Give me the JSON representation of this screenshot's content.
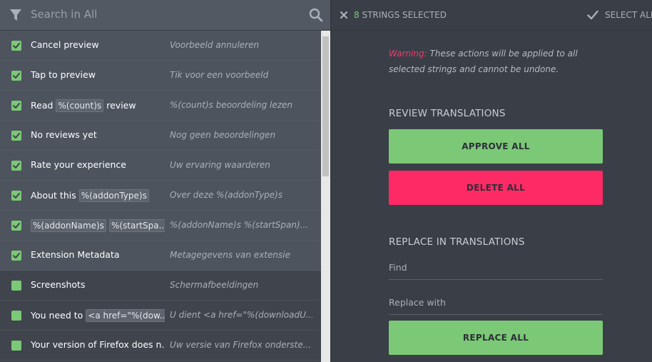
{
  "search": {
    "placeholder": "Search in All"
  },
  "strings": [
    {
      "selected": true,
      "source": [
        {
          "t": "Cancel preview"
        }
      ],
      "translation": "Voorbeeld annuleren"
    },
    {
      "selected": true,
      "source": [
        {
          "t": "Tap to preview"
        }
      ],
      "translation": "Tik voor een voorbeeld"
    },
    {
      "selected": true,
      "source": [
        {
          "t": "Read "
        },
        {
          "p": "%(count)s"
        },
        {
          "t": " review"
        }
      ],
      "translation": "%(count)s beoordeling lezen"
    },
    {
      "selected": true,
      "source": [
        {
          "t": "No reviews yet"
        }
      ],
      "translation": "Nog geen beoordelingen"
    },
    {
      "selected": true,
      "source": [
        {
          "t": "Rate your experience"
        }
      ],
      "translation": "Uw ervaring waarderen"
    },
    {
      "selected": true,
      "source": [
        {
          "t": "About this "
        },
        {
          "p": "%(addonType)s"
        }
      ],
      "translation": "Over deze %(addonType)s"
    },
    {
      "selected": true,
      "source": [
        {
          "p": "%(addonName)s"
        },
        {
          "t": " "
        },
        {
          "p": "%(startSpa..."
        }
      ],
      "translation": "%(addonName)s %(startSpan)..."
    },
    {
      "selected": true,
      "source": [
        {
          "t": "Extension Metadata"
        }
      ],
      "translation": "Metagegevens van extensie"
    },
    {
      "selected": false,
      "source": [
        {
          "t": "Screenshots"
        }
      ],
      "translation": "Schermafbeeldingen"
    },
    {
      "selected": false,
      "source": [
        {
          "t": "You need to "
        },
        {
          "p": "<a href=\"%(dow..."
        }
      ],
      "translation": "U dient <a href=\"%(downloadU..."
    },
    {
      "selected": false,
      "source": [
        {
          "t": "Your version of Firefox does n..."
        }
      ],
      "translation": "Uw versie van Firefox onderste..."
    }
  ],
  "mass_actions": {
    "selected_count": "8",
    "selected_label": "STRINGS SELECTED",
    "select_all": "SELECT ALL",
    "warning_label": "Warning:",
    "warning_text": "These actions will be applied to all selected strings and cannot be undone.",
    "review_title": "REVIEW TRANSLATIONS",
    "approve_all": "APPROVE ALL",
    "delete_all": "DELETE ALL",
    "replace_title": "REPLACE IN TRANSLATIONS",
    "find_placeholder": "Find",
    "replace_placeholder": "Replace with",
    "replace_all": "REPLACE ALL"
  },
  "colors": {
    "accent_green": "#7bc876",
    "danger_red": "#fe2a65"
  },
  "icons": {
    "filter": "filter-icon",
    "search": "search-icon",
    "close": "close-icon",
    "select_all": "check-icon"
  }
}
